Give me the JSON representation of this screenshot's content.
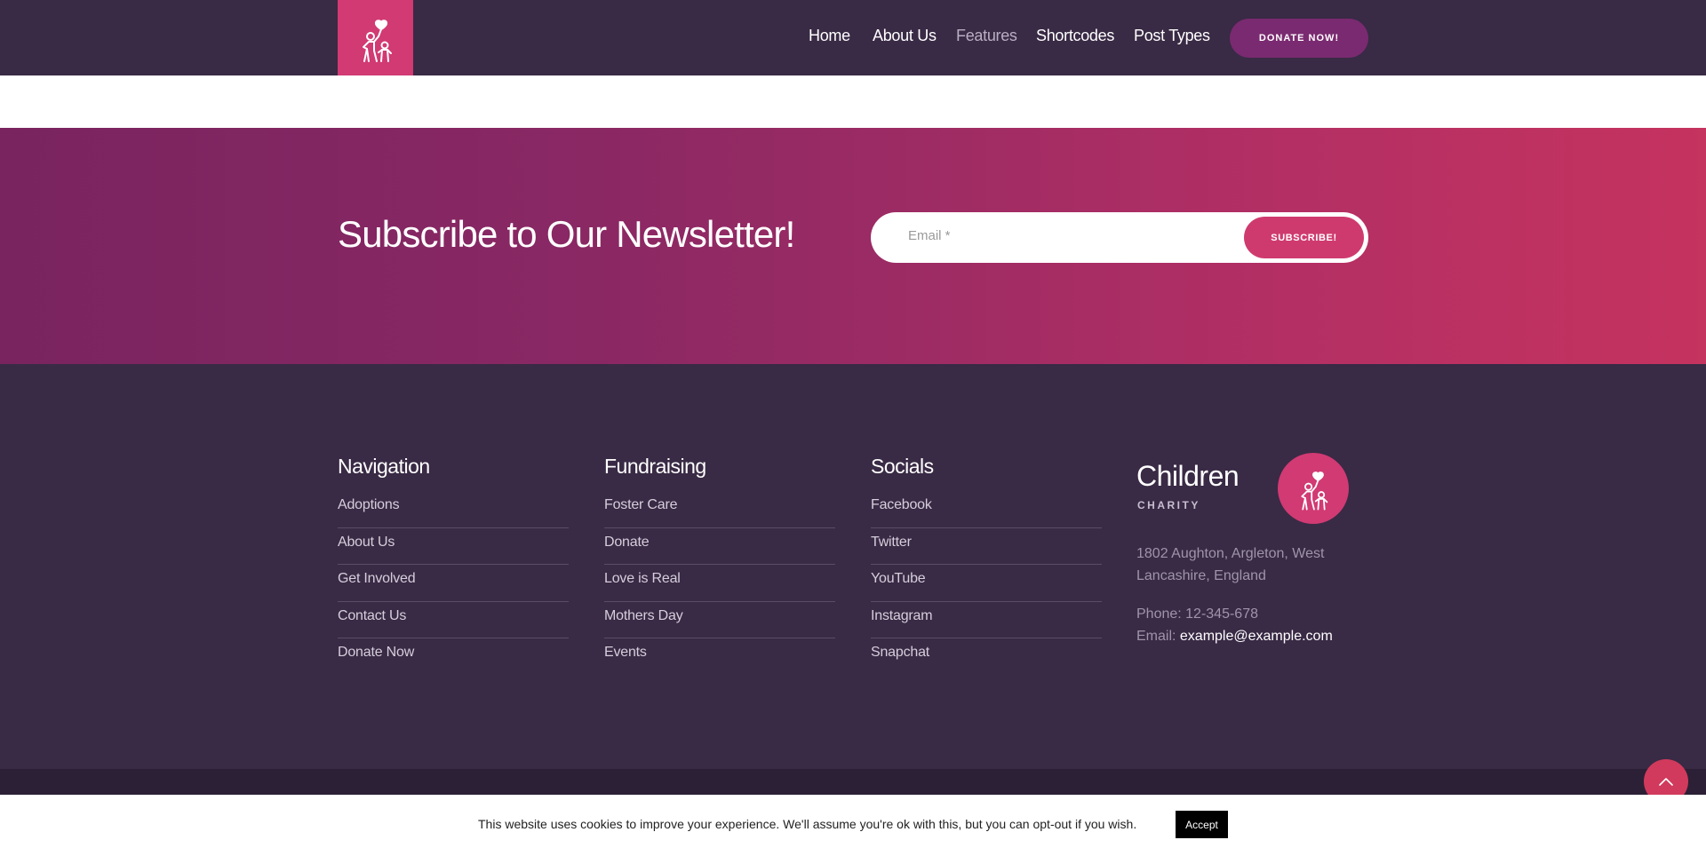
{
  "header": {
    "nav": [
      {
        "label": "Home",
        "active": false
      },
      {
        "label": "About Us",
        "active": false
      },
      {
        "label": "Features",
        "active": true
      },
      {
        "label": "Shortcodes",
        "active": false
      },
      {
        "label": "Post Types",
        "active": false
      }
    ],
    "donate_label": "DONATE NOW!",
    "logo_icon": "family-heart-icon"
  },
  "newsletter": {
    "title": "Subscribe to Our Newsletter!",
    "email_placeholder": "Email *",
    "button_label": "SUBSCRIBE!"
  },
  "footer": {
    "columns": [
      {
        "heading": "Navigation",
        "links": [
          "Adoptions",
          "About Us",
          "Get Involved",
          "Contact Us",
          "Donate Now"
        ]
      },
      {
        "heading": "Fundraising",
        "links": [
          "Foster Care",
          "Donate",
          "Love is Real",
          "Mothers Day",
          "Events"
        ]
      },
      {
        "heading": "Socials",
        "links": [
          "Facebook",
          "Twitter",
          "YouTube",
          "Instagram",
          "Snapchat"
        ]
      }
    ],
    "brand": {
      "name": "Children",
      "subtitle": "CHARITY",
      "address": "1802 Aughton, Argleton, West Lancashire, England",
      "phone": "Phone: 12-345-678",
      "email_prefix": "Email: ",
      "email": "example@example.com"
    }
  },
  "cookie": {
    "text": "This website uses cookies to improve your experience. We'll assume you're ok with this, but you can opt-out if you wish.",
    "accept_label": "Accept"
  },
  "colors": {
    "header_bg": "#392a45",
    "accent_pink": "#d13a73",
    "donate_purple": "#7a2a70"
  }
}
